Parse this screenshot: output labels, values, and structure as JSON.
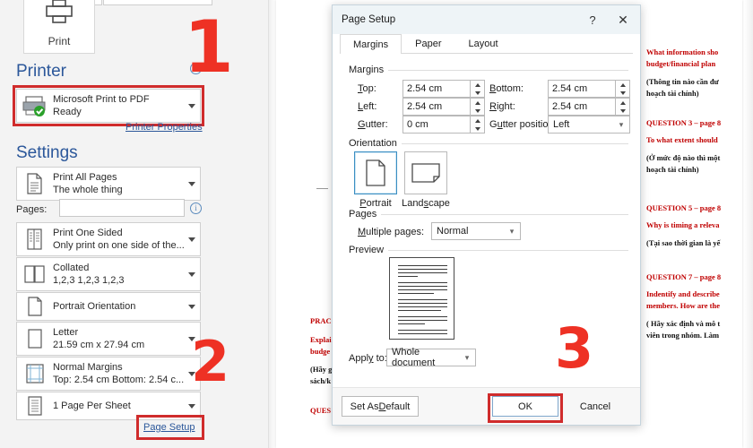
{
  "print_pane": {
    "print_button_label": "Print",
    "printer_heading": "Printer",
    "printer_name": "Microsoft Print to PDF",
    "printer_status": "Ready",
    "printer_properties_link": "Printer Properties",
    "settings_heading": "Settings",
    "pages_label": "Pages:",
    "pages_value": "",
    "page_setup_link": "Page Setup",
    "settings_items": [
      {
        "title": "Print All Pages",
        "subtitle": "The whole thing",
        "icon": "document-pages-icon"
      },
      {
        "title": "Print One Sided",
        "subtitle": "Only print on one side of the...",
        "icon": "one-sided-icon"
      },
      {
        "title": "Collated",
        "subtitle": "1,2,3    1,2,3    1,2,3",
        "icon": "collated-icon"
      },
      {
        "title": "Portrait Orientation",
        "subtitle": "",
        "icon": "portrait-icon"
      },
      {
        "title": "Letter",
        "subtitle": "21.59 cm x 27.94 cm",
        "icon": "paper-size-icon"
      },
      {
        "title": "Normal Margins",
        "subtitle": "Top: 2.54 cm Bottom: 2.54 c...",
        "icon": "margins-icon"
      },
      {
        "title": "1 Page Per Sheet",
        "subtitle": "",
        "icon": "pages-per-sheet-icon"
      }
    ]
  },
  "dialog": {
    "title": "Page Setup",
    "help_glyph": "?",
    "close_glyph": "✕",
    "tabs": [
      {
        "label": "Margins",
        "active": true
      },
      {
        "label": "Paper",
        "active": false
      },
      {
        "label": "Layout",
        "active": false
      }
    ],
    "margins_group": {
      "label": "Margins",
      "top_label": "Top:",
      "top_value": "2.54 cm",
      "bottom_label": "Bottom:",
      "bottom_value": "2.54 cm",
      "left_label": "Left:",
      "left_value": "2.54 cm",
      "right_label": "Right:",
      "right_value": "2.54 cm",
      "gutter_label": "Gutter:",
      "gutter_value": "0 cm",
      "gutter_position_label": "Gutter position:",
      "gutter_position_value": "Left"
    },
    "orientation_group": {
      "label": "Orientation",
      "portrait_caption": "Portrait",
      "landscape_caption": "Landscape",
      "selected": "Portrait"
    },
    "pages_group": {
      "label": "Pages",
      "multiple_pages_label": "Multiple pages:",
      "multiple_pages_value": "Normal"
    },
    "preview_group": {
      "label": "Preview",
      "apply_to_label": "Apply to:",
      "apply_to_value": "Whole document"
    },
    "buttons": {
      "set_as_default": "Set As Default",
      "ok": "OK",
      "cancel": "Cancel"
    }
  },
  "document": {
    "lines": [
      {
        "text": "PRAC",
        "color": "red"
      },
      {
        "text": "Explai",
        "color": "red"
      },
      {
        "text": "budge",
        "color": "red"
      },
      {
        "text": "(Hãy g",
        "color": "black"
      },
      {
        "text": "sách/k",
        "color": "black"
      },
      {
        "text": "QUES",
        "color": "red"
      },
      {
        "text": "What information sho",
        "color": "red"
      },
      {
        "text": "budget/financial plan",
        "color": "red"
      },
      {
        "text": "(Thông tin nào cần đư",
        "color": "black"
      },
      {
        "text": "hoạch tài chính)",
        "color": "black"
      },
      {
        "text": "QUESTION 3 – page 8",
        "color": "red"
      },
      {
        "text": "To what extent should",
        "color": "red"
      },
      {
        "text": "(Ở mức độ nào thì một",
        "color": "black"
      },
      {
        "text": "hoạch tài chính)",
        "color": "black"
      },
      {
        "text": "QUESTION 5 – page 8",
        "color": "red"
      },
      {
        "text": "Why is timing a releva",
        "color": "red"
      },
      {
        "text": "(Tại sao thời gian là yế",
        "color": "black"
      },
      {
        "text": "QUESTION 7 – page 8",
        "color": "red"
      },
      {
        "text": "Indentify and describe",
        "color": "red"
      },
      {
        "text": "members. How are the",
        "color": "red"
      },
      {
        "text": "( Hãy xác định và mô t",
        "color": "black"
      },
      {
        "text": "viên trong nhóm. Làm",
        "color": "black"
      }
    ]
  },
  "annotations": {
    "step1": "1",
    "step2": "2",
    "step3": "3",
    "highlight_color": "#d02c2c",
    "number_color": "#ee3124"
  }
}
